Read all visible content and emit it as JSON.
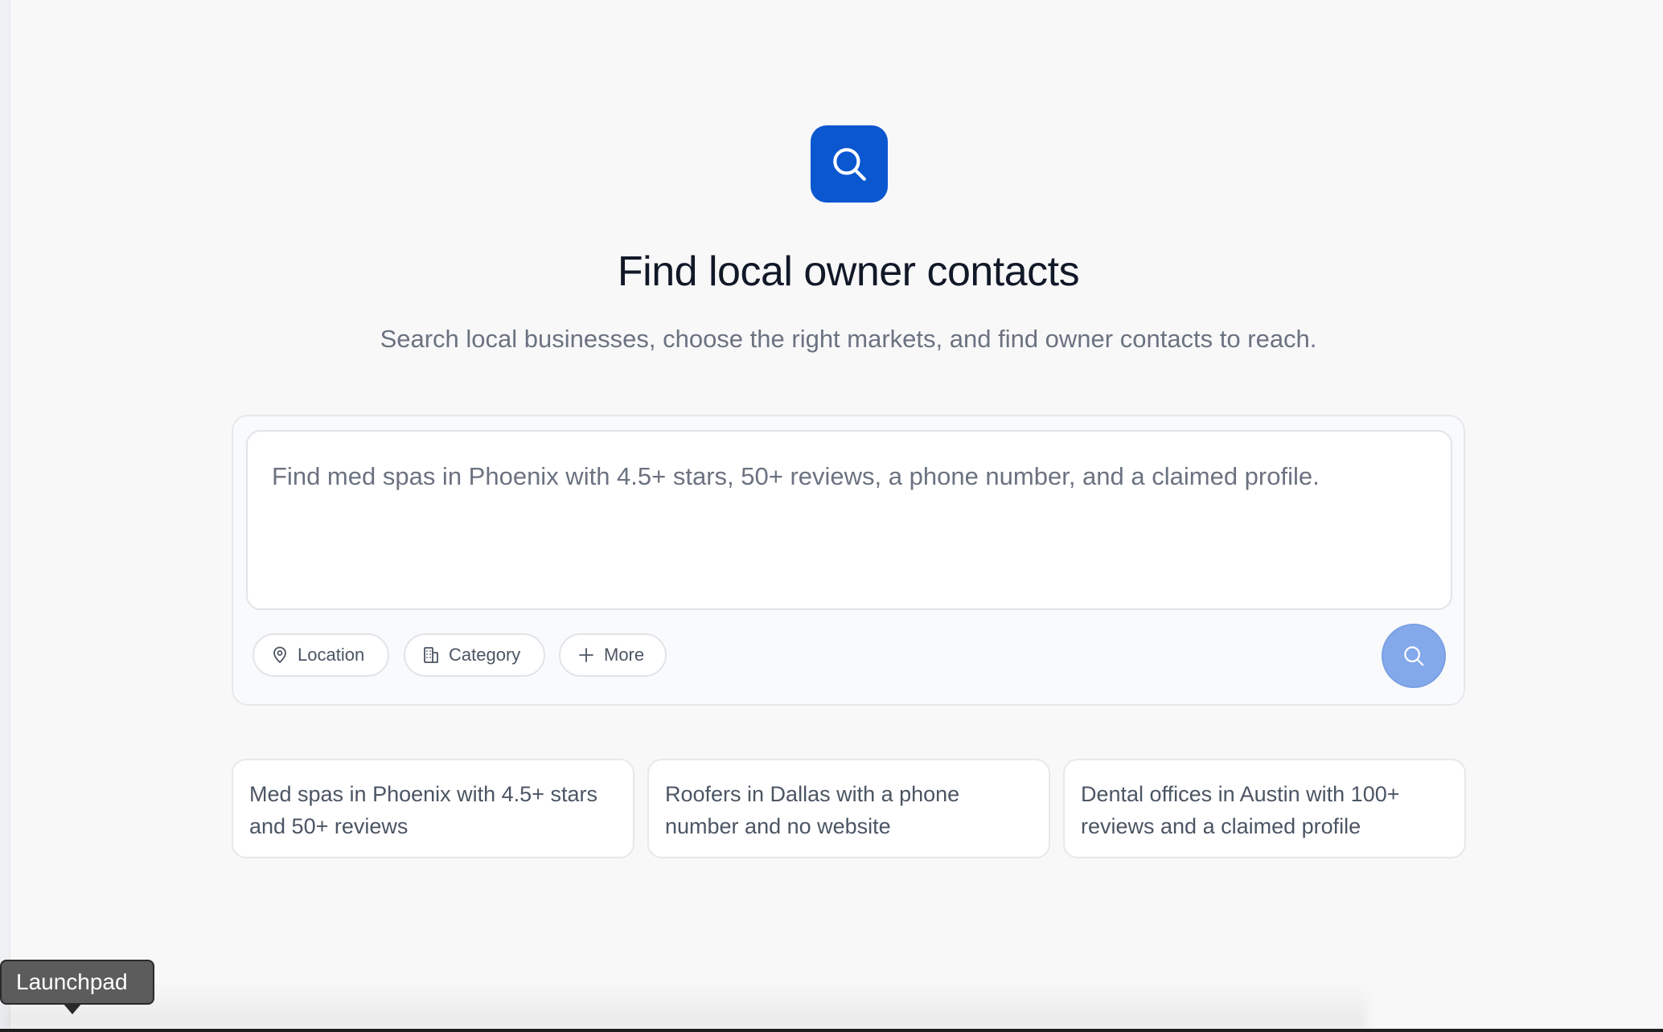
{
  "hero": {
    "icon": "search-icon",
    "title": "Find local owner contacts",
    "subtitle": "Search local businesses, choose the right markets, and find owner contacts to reach."
  },
  "search": {
    "placeholder": "Find med spas in Phoenix with 4.5+ stars, 50+ reviews, a phone number, and a claimed profile.",
    "chips": {
      "location": {
        "label": "Location",
        "icon": "map-pin-icon"
      },
      "category": {
        "label": "Category",
        "icon": "building-icon"
      },
      "more": {
        "label": "More",
        "icon": "plus-icon"
      }
    },
    "submit_icon": "search-icon"
  },
  "suggestions": [
    {
      "text": "Med spas in Phoenix with 4.5+ stars and 50+ reviews"
    },
    {
      "text": "Roofers in Dallas with a phone number and no website"
    },
    {
      "text": "Dental offices in Austin with 100+ reviews and a claimed profile"
    }
  ],
  "dock": {
    "tooltip": "Launchpad"
  },
  "colors": {
    "accent": "#0b57d0",
    "submit_disabled": "#84a9ea",
    "background": "#f8f8f9",
    "text_primary": "#111827",
    "text_secondary": "#6b7280"
  }
}
